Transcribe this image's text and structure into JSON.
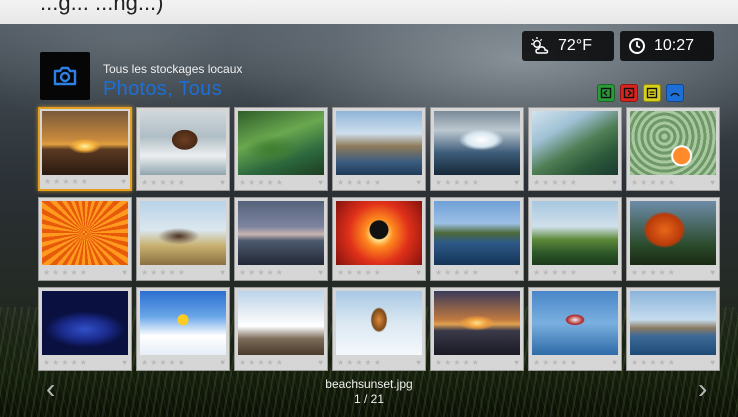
{
  "header": {
    "top_fragment": "...g... ...ng...)",
    "path_label": "Tous les stockages locaux",
    "section_title": "Photos, Tous"
  },
  "status": {
    "temperature": "72°F",
    "time": "10:27",
    "weather_icon": "partly-cloudy-icon",
    "clock_icon": "clock-icon"
  },
  "toolbar": {
    "buttons": [
      {
        "name": "green-button",
        "color": "#2a9a3b",
        "icon": "enter-icon"
      },
      {
        "name": "red-button",
        "color": "#d6261f",
        "icon": "exit-icon"
      },
      {
        "name": "yellow-button",
        "color": "#d7cf1e",
        "icon": "list-icon"
      },
      {
        "name": "blue-button",
        "color": "#1d6ed6",
        "icon": "dial-icon"
      }
    ]
  },
  "grid": {
    "rows": 3,
    "columns": 7,
    "selected_index": 0,
    "items": [
      {
        "name": "beach-sunset-photo"
      },
      {
        "name": "bear-photo"
      },
      {
        "name": "green-valley-photo"
      },
      {
        "name": "coastal-town-photo"
      },
      {
        "name": "waves-photo"
      },
      {
        "name": "crocodile-photo"
      },
      {
        "name": "clownfish-photo"
      },
      {
        "name": "orange-coral-photo"
      },
      {
        "name": "horses-photo"
      },
      {
        "name": "lake-dusk-photo"
      },
      {
        "name": "bmx-rider-photo"
      },
      {
        "name": "mountain-lake-photo"
      },
      {
        "name": "cliffs-photo"
      },
      {
        "name": "autumn-tree-photo"
      },
      {
        "name": "blue-clam-photo"
      },
      {
        "name": "snowboarder-photo"
      },
      {
        "name": "snowy-village-photo"
      },
      {
        "name": "tiger-snow-photo"
      },
      {
        "name": "harbor-sunset-photo"
      },
      {
        "name": "seaplane-photo"
      },
      {
        "name": "venice-photo"
      }
    ],
    "rating_stars": "★★★★★",
    "heart": "♥"
  },
  "footer": {
    "filename": "beachsunset.jpg",
    "page_count": "1 / 21",
    "prev": "‹",
    "next": "›"
  }
}
